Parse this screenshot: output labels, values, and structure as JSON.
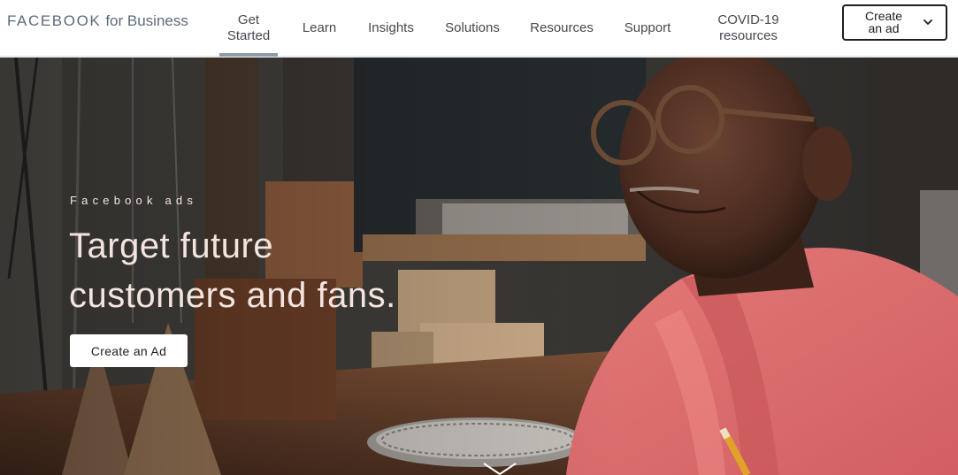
{
  "header": {
    "logo_brand": "FACEBOOK",
    "logo_sub": "for Business",
    "nav": [
      {
        "line1": "Get",
        "line2": "Started"
      },
      {
        "line1": "Learn",
        "line2": ""
      },
      {
        "line1": "Insights",
        "line2": ""
      },
      {
        "line1": "Solutions",
        "line2": ""
      },
      {
        "line1": "Resources",
        "line2": ""
      },
      {
        "line1": "Support",
        "line2": ""
      },
      {
        "line1": "COVID-19",
        "line2": "resources"
      }
    ],
    "active_nav": "Get Started",
    "cta": {
      "line1": "Create",
      "line2": "an ad",
      "icon": "chevron-down-icon"
    }
  },
  "hero": {
    "eyebrow": "Facebook ads",
    "headline_line1": "Target future",
    "headline_line2": "customers and fans.",
    "button_label": "Create an Ad",
    "scroll_icon": "chevron-down-icon"
  },
  "colors": {
    "logo": "#5b6a7a",
    "nav_text": "#444950",
    "active_underline": "#8d9aa8",
    "headline": "#f4e4e0",
    "shirt": "#e06e6f"
  }
}
